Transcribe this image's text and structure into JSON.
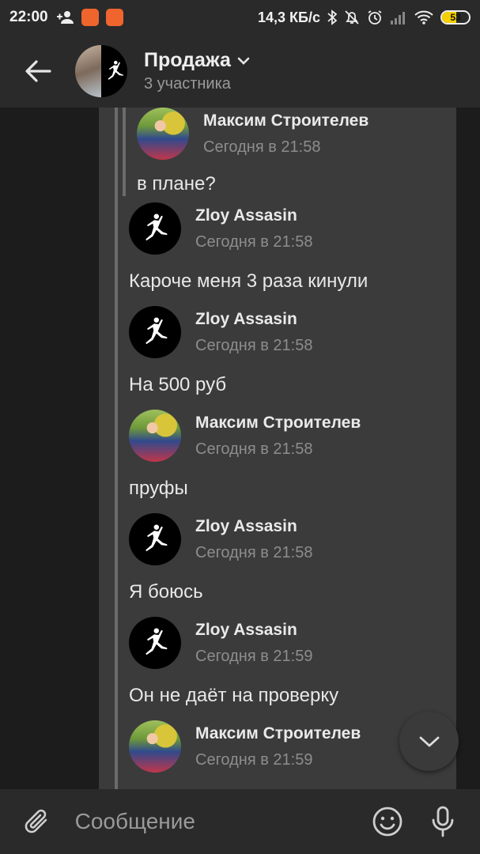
{
  "status_bar": {
    "time": "22:00",
    "speed": "14,3 КБ/с",
    "battery": "53",
    "battery_level": 0.53
  },
  "header": {
    "title": "Продажа",
    "subtitle": "3 участника"
  },
  "messages": [
    {
      "sender": "Максим Строителев",
      "time": "Сегодня в 21:58",
      "text": "в плане?",
      "avatar": "photo"
    },
    {
      "sender": "Zloy Assasin",
      "time": "Сегодня в 21:58",
      "text": "Кароче меня 3 раза кинули",
      "avatar": "jordan-logo"
    },
    {
      "sender": "Zloy Assasin",
      "time": "Сегодня в 21:58",
      "text": "На 500 руб",
      "avatar": "jordan-logo"
    },
    {
      "sender": "Максим Строителев",
      "time": "Сегодня в 21:58",
      "text": "пруфы",
      "avatar": "photo"
    },
    {
      "sender": "Zloy Assasin",
      "time": "Сегодня в 21:58",
      "text": "Я боюсь",
      "avatar": "jordan-logo"
    },
    {
      "sender": "Zloy Assasin",
      "time": "Сегодня в 21:59",
      "text": "Он не даёт на проверку",
      "avatar": "jordan-logo"
    },
    {
      "sender": "Максим Строителев",
      "time": "Сегодня в 21:59",
      "avatar": "photo"
    }
  ],
  "composer": {
    "placeholder": "Сообщение"
  },
  "colors": {
    "background": "#191919",
    "panel": "#3b3b3c",
    "bar": "#2a2a2b"
  }
}
